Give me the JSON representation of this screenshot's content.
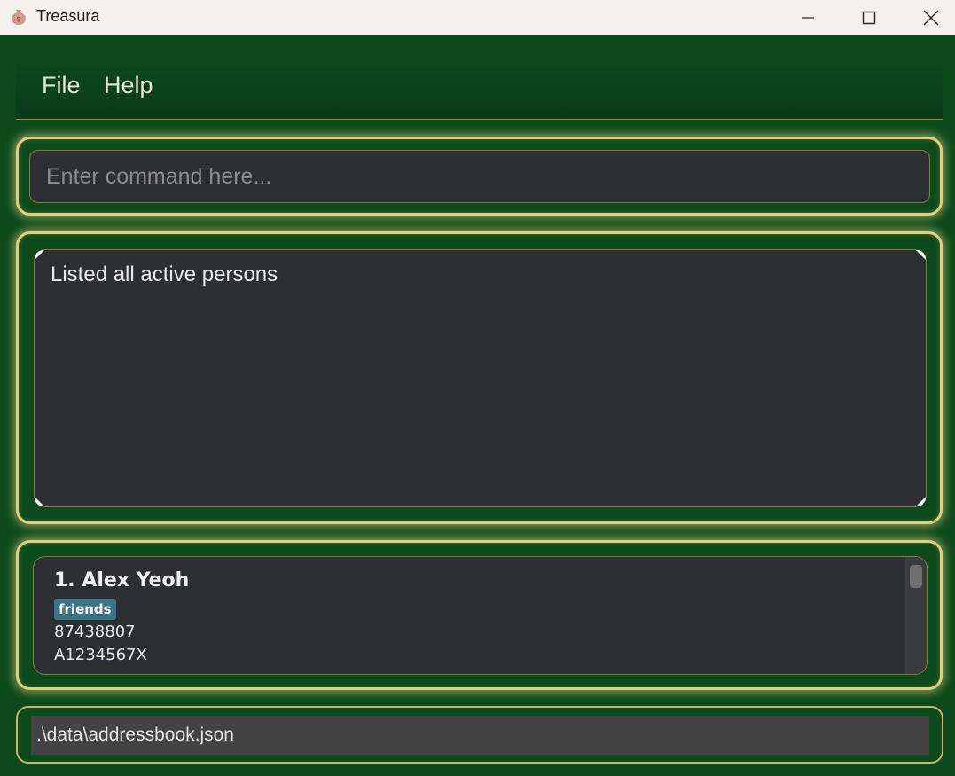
{
  "window": {
    "title": "Treasura",
    "icons": {
      "app": "money-bag-icon",
      "minimize": "minimize-icon",
      "maximize": "maximize-icon",
      "close": "close-icon"
    }
  },
  "menu": {
    "items": [
      {
        "label": "File"
      },
      {
        "label": "Help"
      }
    ]
  },
  "command": {
    "placeholder": "Enter command here..."
  },
  "result": {
    "text": "Listed all active persons"
  },
  "persons": [
    {
      "index": "1.",
      "name": "Alex Yeoh",
      "tags": [
        "friends"
      ],
      "phone": "87438807",
      "id": "A1234567X"
    }
  ],
  "status": {
    "path": ".\\data\\addressbook.json"
  },
  "colors": {
    "background": "#0c4a1c",
    "glow_border": "#e3cd7e",
    "panel_fill": "#2e2f33",
    "tag": "#3b7487",
    "titlebar": "#f3f1ec"
  }
}
